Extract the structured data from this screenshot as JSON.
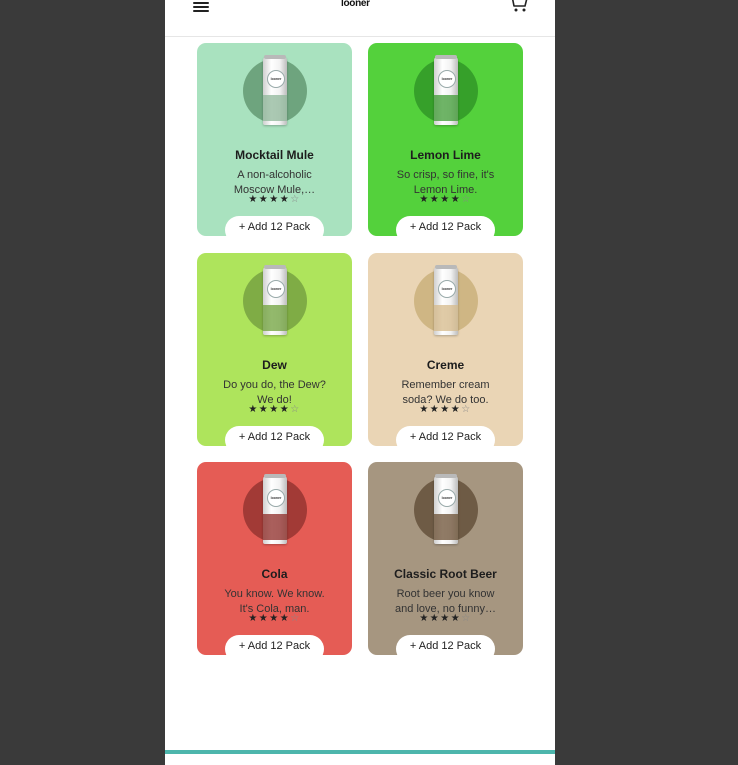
{
  "header": {
    "logo_text": "looner",
    "menu_icon": "hamburger-menu-icon",
    "cart_icon": "cart-icon"
  },
  "products": [
    {
      "name": "Mocktail Mule",
      "description": "A non-alcoholic Moscow Mule,…",
      "rating": 4,
      "rating_max": 5,
      "button_label": "+ Add 12 Pack",
      "card_color": "#a9e2bf",
      "circle_color": "#6ea47e",
      "band_color": "#8fb79a"
    },
    {
      "name": "Lemon Lime",
      "description": "So crisp, so fine, it's Lemon Lime.",
      "rating": 4,
      "rating_max": 5,
      "button_label": "+ Add 12 Pack",
      "card_color": "#54d13c",
      "circle_color": "#36a02a",
      "band_color": "#3f9b34"
    },
    {
      "name": "Dew",
      "description": "Do you do, the Dew? We do!",
      "rating": 4,
      "rating_max": 5,
      "button_label": "+ Add 12 Pack",
      "card_color": "#aee45c",
      "circle_color": "#7fac45",
      "band_color": "#6fa23b"
    },
    {
      "name": "Creme",
      "description": "Remember cream soda? We do too.",
      "rating": 4,
      "rating_max": 5,
      "button_label": "+ Add 12 Pack",
      "card_color": "#ead5b5",
      "circle_color": "#cfb684",
      "band_color": "#d6b98a"
    },
    {
      "name": "Cola",
      "description": "You know. We know. It's Cola, man.",
      "rating": 4,
      "rating_max": 5,
      "button_label": "+ Add 12 Pack",
      "card_color": "#e55c55",
      "circle_color": "#a23a36",
      "band_color": "#8e2a26"
    },
    {
      "name": "Classic Root Beer",
      "description": "Root beer you know and love, no funny…",
      "rating": 4,
      "rating_max": 5,
      "button_label": "+ Add 12 Pack",
      "card_color": "#a69680",
      "circle_color": "#6e5b45",
      "band_color": "#6b4f33"
    }
  ],
  "colors": {
    "accent": "#4db6ac",
    "backdrop": "#3a3a3a"
  }
}
